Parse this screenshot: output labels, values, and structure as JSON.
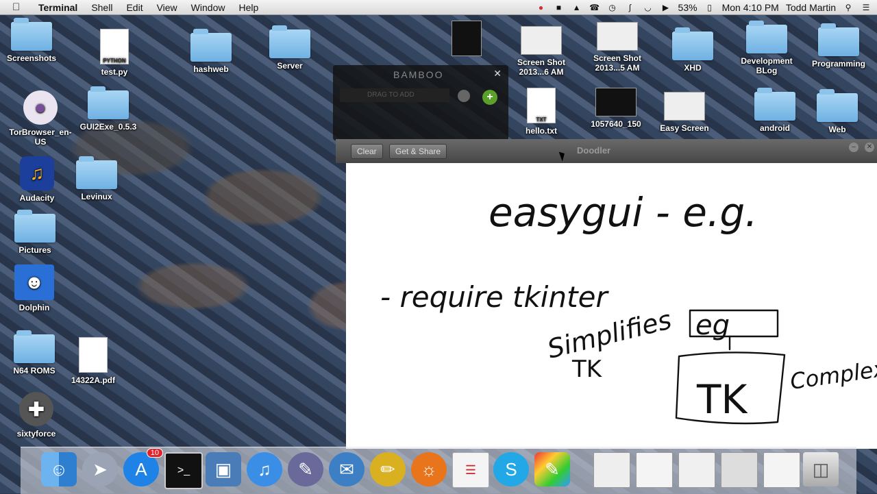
{
  "menubar": {
    "app_name": "Terminal",
    "menus": [
      "Shell",
      "Edit",
      "View",
      "Window",
      "Help"
    ],
    "battery": "53%",
    "clock": "Mon 4:10 PM",
    "user": "Todd Martin"
  },
  "desktop_icons": [
    {
      "label": "Screenshots",
      "kind": "folder"
    },
    {
      "label": "test.py",
      "kind": "file",
      "tag": "PYTHON"
    },
    {
      "label": "hashweb",
      "kind": "folder"
    },
    {
      "label": "Server",
      "kind": "folder"
    },
    {
      "label": "TorBrowser_en-US",
      "kind": "app"
    },
    {
      "label": "GUI2Exe_0.5.3",
      "kind": "folder"
    },
    {
      "label": "Audacity",
      "kind": "app"
    },
    {
      "label": "Levinux",
      "kind": "folder"
    },
    {
      "label": "Pictures",
      "kind": "folder"
    },
    {
      "label": "Dolphin",
      "kind": "app"
    },
    {
      "label": "N64 ROMS",
      "kind": "folder"
    },
    {
      "label": "14322A.pdf",
      "kind": "file"
    },
    {
      "label": "sixtyforce",
      "kind": "app"
    },
    {
      "label": "Screen Shot 2013...6 AM",
      "kind": "thumb"
    },
    {
      "label": "Screen Shot 2013...5 AM",
      "kind": "thumb"
    },
    {
      "label": "XHD",
      "kind": "folder"
    },
    {
      "label": "Development BLog",
      "kind": "folder"
    },
    {
      "label": "Programming",
      "kind": "folder"
    },
    {
      "label": "hello.txt",
      "kind": "file",
      "tag": "TXT"
    },
    {
      "label": "1057640_150",
      "kind": "thumb"
    },
    {
      "label": "Easy Screen",
      "kind": "thumb"
    },
    {
      "label": "android",
      "kind": "folder"
    },
    {
      "label": "Web",
      "kind": "folder"
    }
  ],
  "bamboo": {
    "logo": "BAMBOO",
    "search_placeholder": "DRAG TO ADD"
  },
  "doodler": {
    "title": "Doodler",
    "clear_label": "Clear",
    "share_label": "Get & Share",
    "handwriting": [
      "easygui - e.g.",
      "- require tkinter",
      "Simplifies",
      "TK",
      "eg",
      "TK",
      "Complex library"
    ]
  },
  "dock": {
    "items": [
      "finder-icon",
      "launchpad-icon",
      "app-store-icon",
      "terminal-icon",
      "virtualbox-icon",
      "itunes-icon",
      "pen-tool-icon",
      "thunderbird-icon",
      "pencil-icon",
      "firefox-icon",
      "dev-notes-icon",
      "skype-icon",
      "brushes-icon",
      "window-thumb-1",
      "window-thumb-2",
      "window-thumb-3",
      "window-thumb-4",
      "window-thumb-5",
      "trash-icon"
    ],
    "app_store_badge": "10"
  }
}
